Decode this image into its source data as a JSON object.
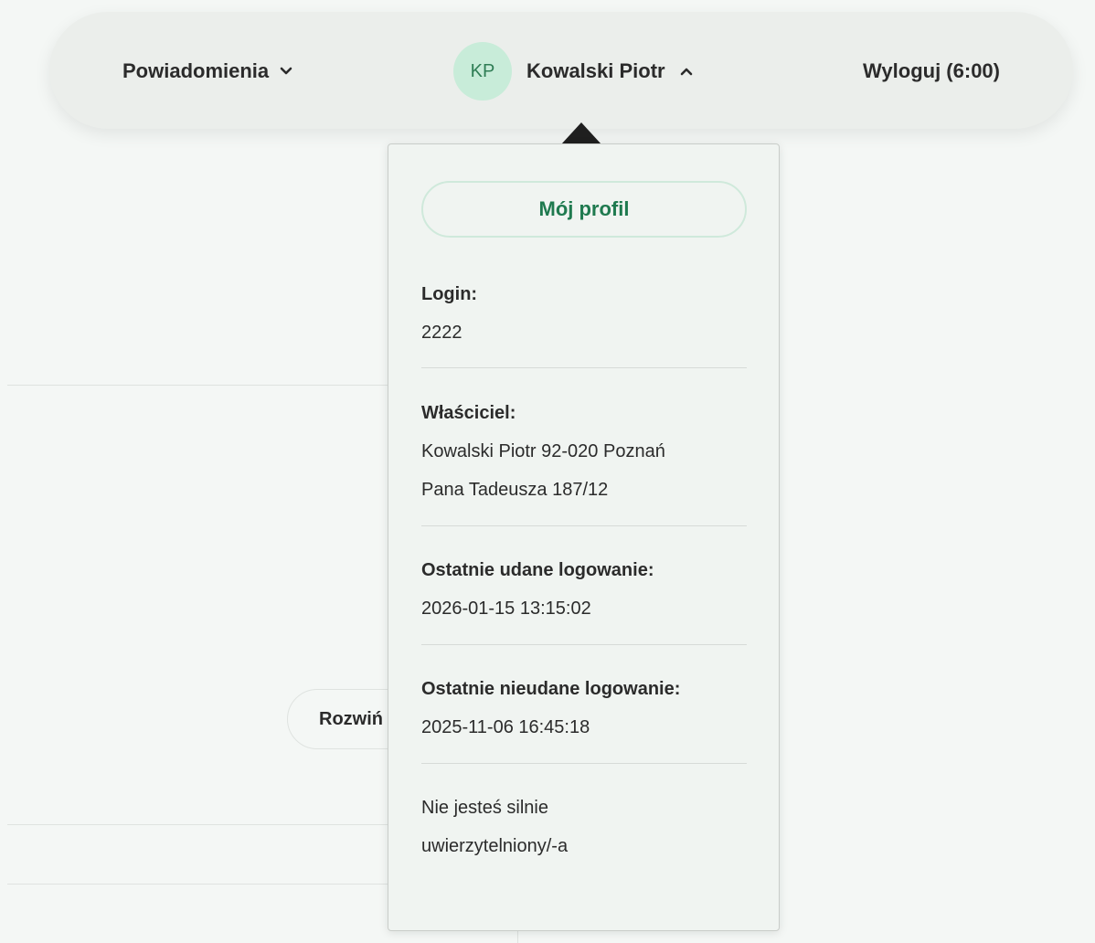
{
  "topbar": {
    "notifications_label": "Powiadomienia",
    "user_initials": "KP",
    "user_name": "Kowalski Piotr",
    "logout_label": "Wyloguj (6:00)"
  },
  "background": {
    "expand_button_label": "Rozwiń"
  },
  "profile_menu": {
    "my_profile_label": "Mój profil",
    "login_label": "Login:",
    "login_value": "2222",
    "owner_label": "Właściciel:",
    "owner_line1": "Kowalski Piotr 92-020 Poznań",
    "owner_line2": "Pana Tadeusza 187/12",
    "last_success_label": "Ostatnie udane logowanie:",
    "last_success_value": "2026-01-15 13:15:02",
    "last_failed_label": "Ostatnie nieudane logowanie:",
    "last_failed_value": "2025-11-06 16:45:18",
    "auth_line1": "Nie jesteś silnie",
    "auth_line2": "uwierzytelniony/-a"
  },
  "colors": {
    "accent_green": "#1f7a4f",
    "avatar_bg": "#c8ecd9"
  }
}
